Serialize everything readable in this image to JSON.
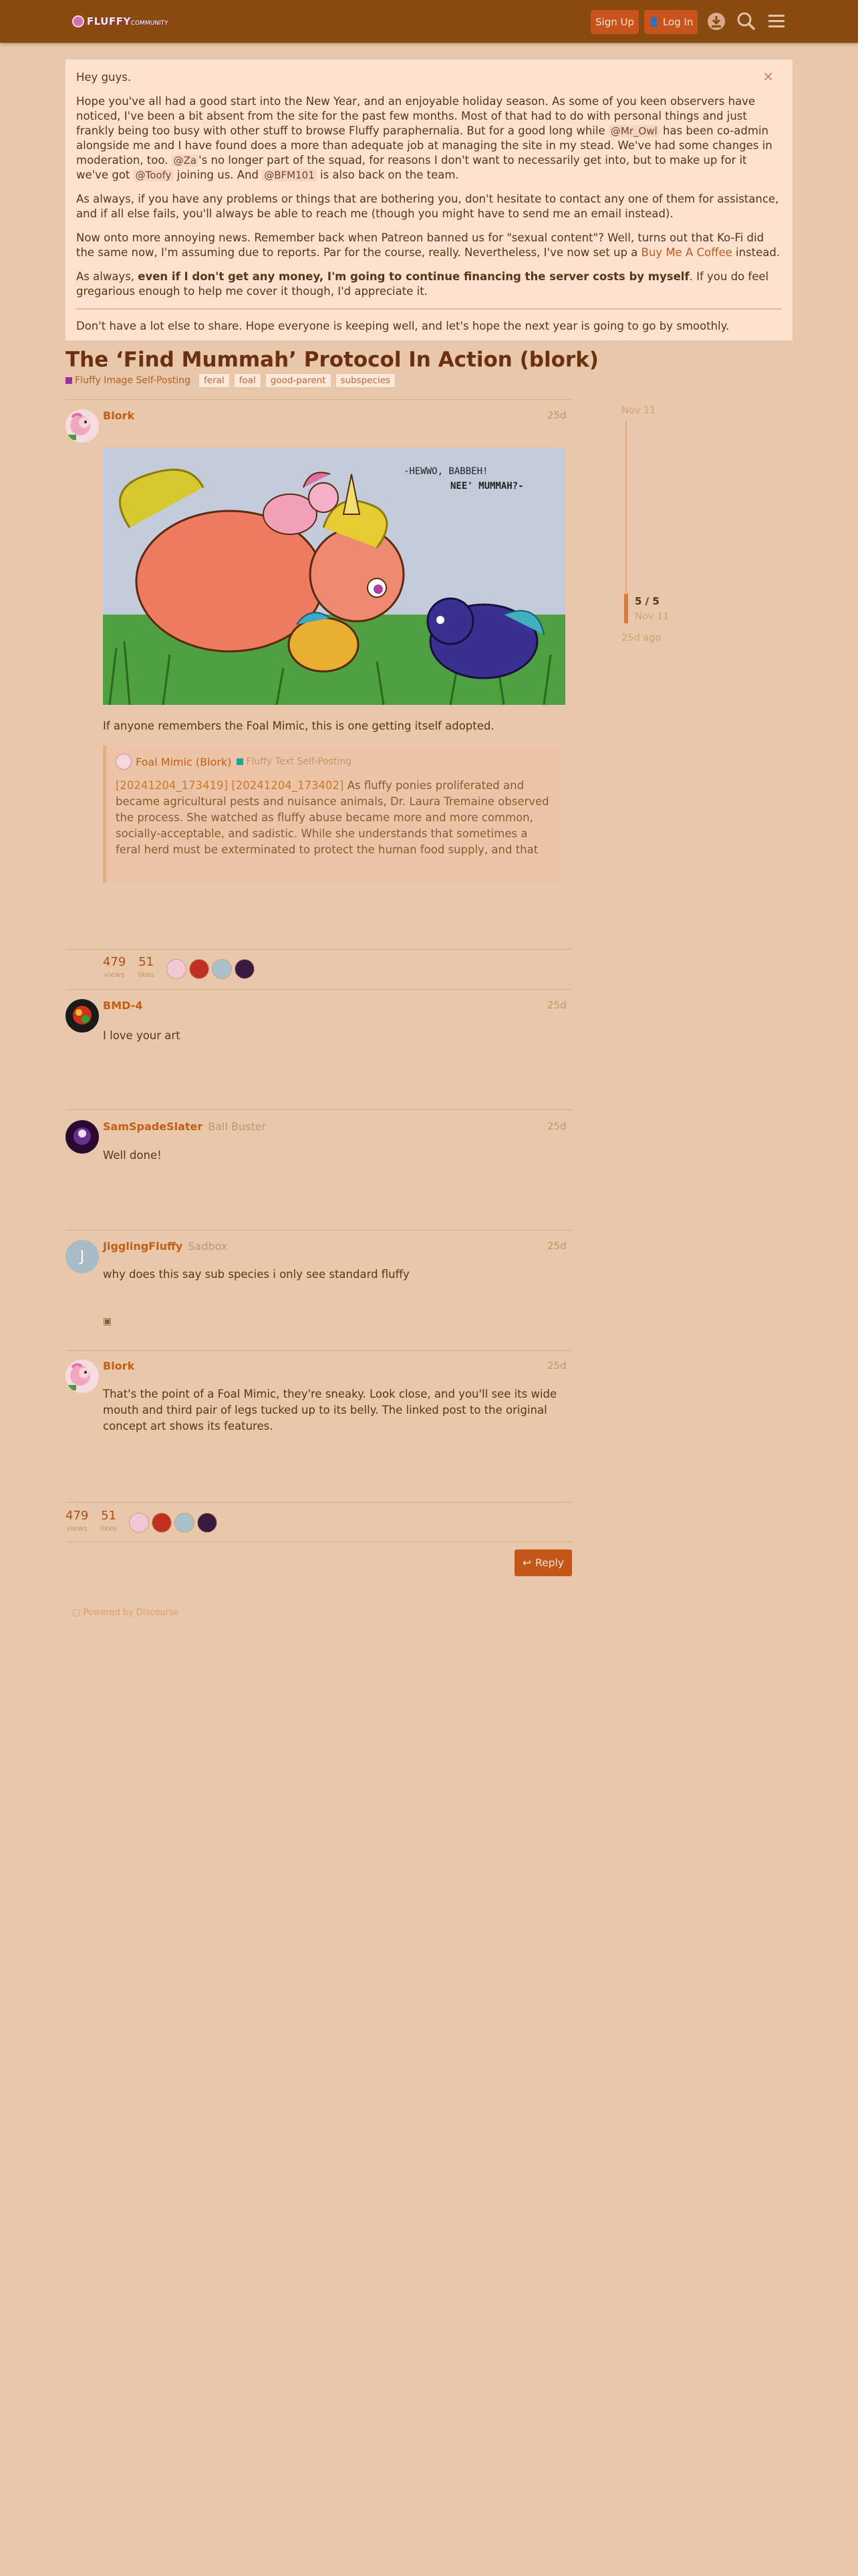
{
  "header": {
    "logo_text": "FLUFFY",
    "logo_sub": "COMMUNITY",
    "signup_label": "Sign Up",
    "login_label": "Log In"
  },
  "banner": {
    "greeting": "Hey guys.",
    "p1_a": "Hope you've all had a good start into the New Year, and an enjoyable holiday season. As some of you keen observers have noticed, I've been a bit absent from the site for the past few months. Most of that had to do with personal things and just frankly being too busy with other stuff to browse Fluffy paraphernalia. But for a good long while",
    "mention_owl": "@Mr_Owl",
    "p1_b": "has been co-admin alongside me and I have found does a more than adequate job at managing the site in my stead. We've had some changes in moderation, too.",
    "mention_za": "@Za",
    "p1_c": "'s no longer part of the squad, for reasons I don't want to necessarily get into, but to make up for it we've got",
    "mention_toofy": "@Toofy",
    "p1_d": "joining us. And",
    "mention_bfm": "@BFM101",
    "p1_e": "is also back on the team.",
    "p2": "As always, if you have any problems or things that are bothering you, don't hesitate to contact any one of them for assistance, and if all else fails, you'll always be able to reach me (though you might have to send me an email instead).",
    "p3_a": "Now onto more annoying news. Remember back when Patreon banned us for \"sexual content\"? Well, turns out that Ko-Fi did the same now, I'm assuming due to reports. Par for the course, really. Nevertheless, I've now set up a",
    "p3_link": "Buy Me A Coffee",
    "p3_b": "instead.",
    "p4_a": "As always,",
    "p4_bold": "even if I don't get any money, I'm going to continue financing the server costs by myself",
    "p4_b": ". If you do feel gregarious enough to help me cover it though, I'd appreciate it.",
    "p5": "Don't have a lot else to share. Hope everyone is keeping well, and let's hope the next year is going to go by smoothly.",
    "close_glyph": "×"
  },
  "topic": {
    "title": "The ‘Find Mummah’ Protocol In Action (blork)",
    "category": "Fluffy Image Self-Posting",
    "category_color": "#9a30a0",
    "tags": [
      "feral",
      "foal",
      "good-parent",
      "subspecies"
    ]
  },
  "posts": [
    {
      "username": "Blork",
      "user_title": "",
      "date": "25d",
      "body": "If anyone remembers the Foal Mimic, this is one getting itself adopted.",
      "image_caption": "-HEWWO, BABBEH! NEE' MUMMAH?-"
    },
    {
      "username": "BMD-4",
      "user_title": "",
      "date": "25d",
      "body": "I love your art"
    },
    {
      "username": "SamSpadeSlater",
      "user_title": "Ball Buster",
      "date": "25d",
      "body": "Well done!"
    },
    {
      "username": "JigglingFluffy",
      "user_title": "Sadbox",
      "date": "25d",
      "body": "why does this say sub species i only see standard fluffy",
      "avatar_letter": "J"
    },
    {
      "username": "Blork",
      "user_title": "",
      "date": "25d",
      "body": "That's the point of a Foal Mimic, they're sneaky. Look close, and you'll see its wide mouth and third pair of legs tucked up to its belly. The linked post to the original concept art shows its features."
    }
  ],
  "quote": {
    "name": "Foal Mimic (Blork)",
    "category": "Fluffy Text Self-Posting",
    "category_color": "#20a0a0",
    "links": "[20241204_173419] [20241204_173402]",
    "text": "As fluffy ponies proliferated and became agricultural pests and nuisance animals, Dr. Laura Tremaine observed the process. She watched as fluffy abuse became more and more common, socially-acceptable, and sadistic. While she understands that sometimes a feral herd must be exterminated to protect the human food supply, and that overpopulation of anything is a disaster, particularly something that was never meant to exist, she hates to see cruelty. Shoot t…"
  },
  "stats": {
    "views": "479",
    "views_label": "views",
    "likes": "51",
    "likes_label": "likes"
  },
  "timeline": {
    "start": "Nov 11",
    "count": "5 / 5",
    "date": "Nov 11",
    "ago": "25d ago"
  },
  "footer": {
    "reply_label": "Reply",
    "powered": "Powered by Discourse"
  }
}
